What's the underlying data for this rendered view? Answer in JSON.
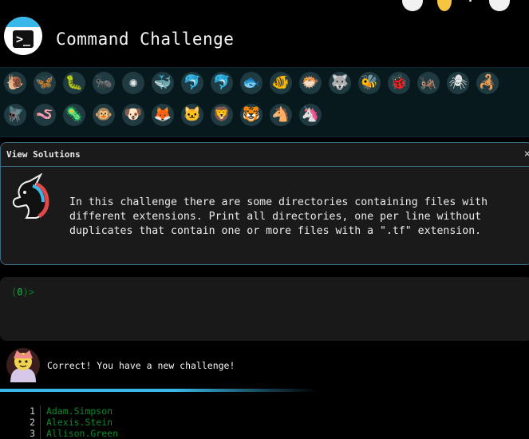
{
  "header": {
    "title": "Command Challenge",
    "logo_icon": "terminal-prompt-icon"
  },
  "top_icons": [
    "circle-icon",
    "lightbulb-icon",
    "pushpin-icon",
    "circle-icon"
  ],
  "animals": {
    "row1": [
      {
        "icon": "snail-icon",
        "glyph": "🐌",
        "color": "#1f3a40"
      },
      {
        "icon": "butterfly-icon",
        "glyph": "🦋",
        "color": "#1f3a40"
      },
      {
        "icon": "caterpillar-icon",
        "glyph": "🐛",
        "color": "#1f3a40"
      },
      {
        "icon": "ant-icon",
        "glyph": "🐜",
        "color": "#1f3a40"
      },
      {
        "icon": "virus-icon",
        "glyph": "✺",
        "color": "#1f3a40"
      },
      {
        "icon": "whale-icon",
        "glyph": "🐳",
        "color": "#1f3a40"
      },
      {
        "icon": "dolphin-icon",
        "glyph": "🐬",
        "color": "#1f3a40"
      },
      {
        "icon": "dolphin-icon",
        "glyph": "🐬",
        "color": "#1f3a40"
      },
      {
        "icon": "fish-icon",
        "glyph": "🐟",
        "color": "#1f3a40"
      },
      {
        "icon": "tropical-fish-icon",
        "glyph": "🐠",
        "color": "#1f3a40"
      },
      {
        "icon": "blowfish-icon",
        "glyph": "🐡",
        "color": "#1f3a40"
      },
      {
        "icon": "wolf-icon",
        "glyph": "🐺",
        "color": "#1f3a40"
      },
      {
        "icon": "bee-icon",
        "glyph": "🐝",
        "color": "#1f3a40"
      },
      {
        "icon": "ladybug-icon",
        "glyph": "🐞",
        "color": "#1f3a40"
      },
      {
        "icon": "grasshopper-icon",
        "glyph": "🦗",
        "color": "#1f3a40"
      },
      {
        "icon": "spider-icon",
        "glyph": "🕷",
        "color": "#1f3a40"
      },
      {
        "icon": "scorpion-icon",
        "glyph": "🦂",
        "color": "#1f3a40"
      }
    ],
    "row2": [
      {
        "icon": "fly-icon",
        "glyph": "🪰",
        "color": "#1f3a40"
      },
      {
        "icon": "worm-icon",
        "glyph": "🪱",
        "color": "#1f3a40"
      },
      {
        "icon": "microbe-icon",
        "glyph": "🦠",
        "color": "#1f3a40"
      },
      {
        "icon": "monkey-icon",
        "glyph": "🐵",
        "color": "#1f3a40"
      },
      {
        "icon": "dog-icon",
        "glyph": "🐶",
        "color": "#1f3a40"
      },
      {
        "icon": "fox-icon",
        "glyph": "🦊",
        "color": "#1f3a40"
      },
      {
        "icon": "cat-icon",
        "glyph": "🐱",
        "color": "#1f3a40"
      },
      {
        "icon": "lion-icon",
        "glyph": "🦁",
        "color": "#1f3a40"
      },
      {
        "icon": "tiger-icon",
        "glyph": "🐯",
        "color": "#1f3a40"
      },
      {
        "icon": "horse-icon",
        "glyph": "🐴",
        "color": "#1f3a40"
      },
      {
        "icon": "unicorn-icon",
        "glyph": "🦄",
        "color": "#1f3a40"
      }
    ]
  },
  "panel": {
    "label": "View Solutions",
    "close": "×",
    "description": "In this challenge there are some directories containing files with different extensions. Print all directories, one per line without duplicates that contain one or more files with a \".tf\" extension."
  },
  "terminal": {
    "count": "0"
  },
  "result": {
    "message": "Correct! You have a new challenge!",
    "progress": 0.6
  },
  "output": [
    {
      "n": "1",
      "text": "Adam.Simpson"
    },
    {
      "n": "2",
      "text": "Alexis.Stein"
    },
    {
      "n": "3",
      "text": "Allison.Green"
    }
  ],
  "colors": {
    "accent": "#38b8e8",
    "panel_border": "#3a6b82",
    "prompt": "#23b14d",
    "output_text": "#0c8a2f"
  }
}
